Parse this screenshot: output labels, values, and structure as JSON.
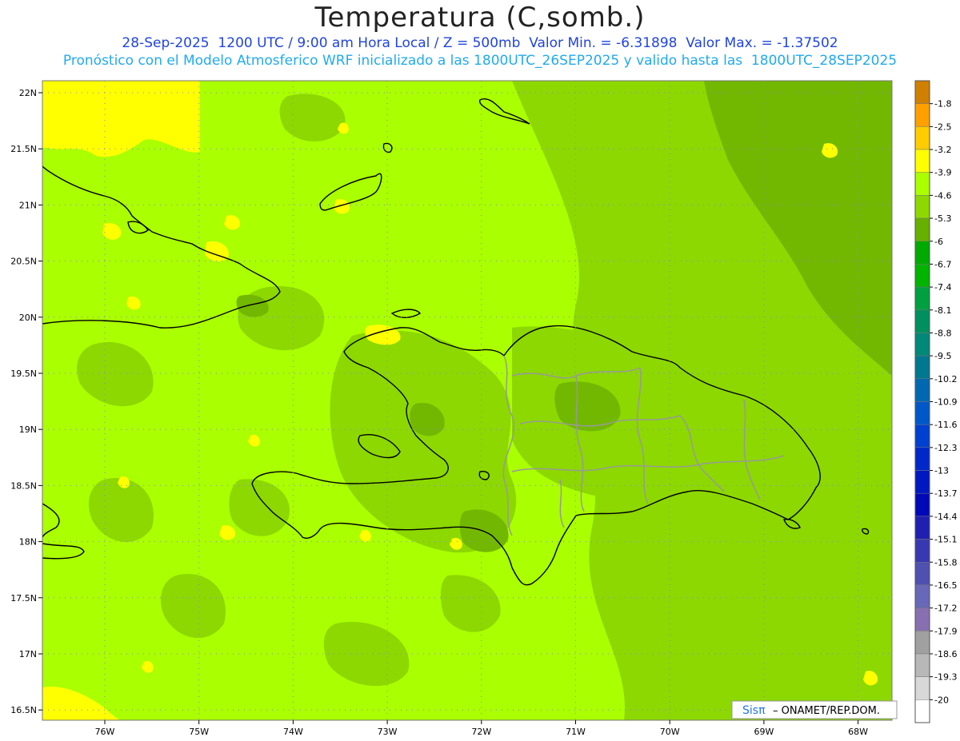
{
  "header": {
    "title": "Temperatura (C,somb.)",
    "line1": "28-Sep-2025  1200 UTC / 9:00 am Hora Local / Z = 500mb  Valor Min. = -6.31898  Valor Max. = -1.37502",
    "line2": "Pronóstico con el Modelo Atmosferico WRF inicializado a las 1800UTC_26SEP2025 y valido hasta las  1800UTC_28SEP2025"
  },
  "map": {
    "lat_labels": [
      "22N",
      "21.5N",
      "21N",
      "20.5N",
      "20N",
      "19.5N",
      "19N",
      "18.5N",
      "18N",
      "17.5N",
      "17N",
      "16.5N"
    ],
    "lon_labels": [
      "76W",
      "75W",
      "74W",
      "73W",
      "72W",
      "71W",
      "70W",
      "69W",
      "68W"
    ],
    "field_colors": {
      "base": "#aaff00",
      "mid": "#8cd800",
      "dark": "#72b800",
      "warm": "#ffff00"
    }
  },
  "colorbar": {
    "levels": [
      {
        "label": "-1.8",
        "color": "#d08000"
      },
      {
        "label": "-2.5",
        "color": "#ffa000"
      },
      {
        "label": "-3.2",
        "color": "#ffcc00"
      },
      {
        "label": "-3.9",
        "color": "#ffff00"
      },
      {
        "label": "-4.6",
        "color": "#aaff00"
      },
      {
        "label": "-5.3",
        "color": "#8cd800"
      },
      {
        "label": "-6",
        "color": "#66b000"
      },
      {
        "label": "-6.7",
        "color": "#00aa00"
      },
      {
        "label": "-7.4",
        "color": "#00b400"
      },
      {
        "label": "-8.1",
        "color": "#00a040"
      },
      {
        "label": "-8.8",
        "color": "#009060"
      },
      {
        "label": "-9.5",
        "color": "#008878"
      },
      {
        "label": "-10.2",
        "color": "#007890"
      },
      {
        "label": "-10.9",
        "color": "#0068b0"
      },
      {
        "label": "-11.6",
        "color": "#0058c8"
      },
      {
        "label": "-12.3",
        "color": "#0040d0"
      },
      {
        "label": "-13",
        "color": "#0028c8"
      },
      {
        "label": "-13.7",
        "color": "#0018c0"
      },
      {
        "label": "-14.4",
        "color": "#0008b8"
      },
      {
        "label": "-15.1",
        "color": "#2020b0"
      },
      {
        "label": "-15.8",
        "color": "#3838b0"
      },
      {
        "label": "-16.5",
        "color": "#5050b0"
      },
      {
        "label": "-17.2",
        "color": "#6868b8"
      },
      {
        "label": "-17.9",
        "color": "#8870b0"
      },
      {
        "label": "-18.6",
        "color": "#a0a0a0"
      },
      {
        "label": "-19.3",
        "color": "#b8b8b8"
      },
      {
        "label": "-20",
        "color": "#d8d8d8"
      },
      {
        "label": "",
        "color": "#ffffff"
      }
    ]
  },
  "credit": {
    "logo_text": "Sisπ",
    "text": " – ONAMET/REP.DOM."
  }
}
